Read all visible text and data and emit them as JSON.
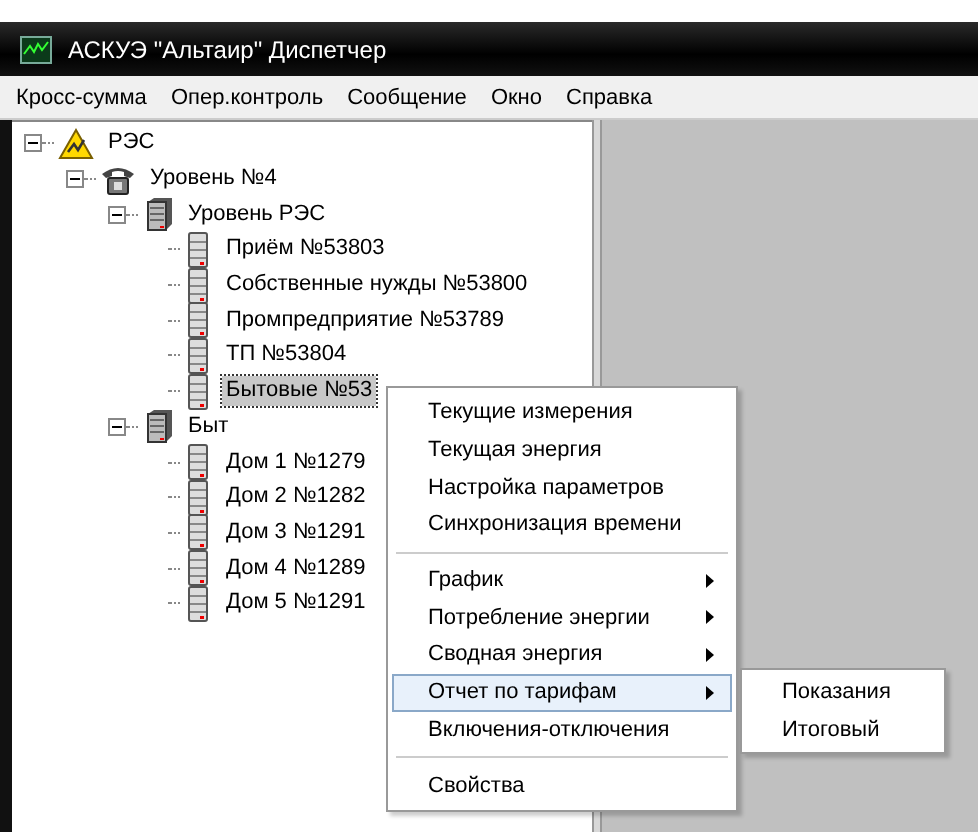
{
  "window": {
    "title": "АСКУЭ \"Альтаир\" Диспетчер"
  },
  "menu_bar": [
    "Кросс-сумма",
    "Опер.контроль",
    "Сообщение",
    "Окно",
    "Справка"
  ],
  "tree": [
    {
      "label": "РЭС",
      "kind": "warning",
      "expanded": true,
      "selected": false,
      "children": [
        {
          "label": "Уровень №4",
          "kind": "phone",
          "expanded": true,
          "selected": false,
          "children": [
            {
              "label": "Уровень РЭС",
              "kind": "server",
              "expanded": true,
              "selected": false,
              "children": [
                {
                  "label": "Приём №53803",
                  "kind": "meter",
                  "selected": false
                },
                {
                  "label": "Собственные нужды №53800",
                  "kind": "meter",
                  "selected": false
                },
                {
                  "label": "Промпредприятие №53789",
                  "kind": "meter",
                  "selected": false
                },
                {
                  "label": "ТП №53804",
                  "kind": "meter",
                  "selected": false
                },
                {
                  "label": "Бытовые №53",
                  "kind": "meter",
                  "selected": true
                }
              ]
            },
            {
              "label": "Быт",
              "kind": "server",
              "expanded": true,
              "selected": false,
              "children": [
                {
                  "label": "Дом 1 №1279",
                  "kind": "meter",
                  "selected": false
                },
                {
                  "label": "Дом 2 №1282",
                  "kind": "meter",
                  "selected": false
                },
                {
                  "label": "Дом 3 №1291",
                  "kind": "meter",
                  "selected": false
                },
                {
                  "label": "Дом 4 №1289",
                  "kind": "meter",
                  "selected": false
                },
                {
                  "label": "Дом 5 №1291",
                  "kind": "meter",
                  "selected": false
                }
              ]
            }
          ]
        }
      ]
    }
  ],
  "context_menu": [
    {
      "kind": "item",
      "label": "Текущие измерения",
      "selected": false
    },
    {
      "kind": "item",
      "label": "Текущая энергия",
      "selected": false
    },
    {
      "kind": "item",
      "label": "Настройка параметров",
      "selected": false
    },
    {
      "kind": "item",
      "label": "Синхронизация времени",
      "selected": false
    },
    {
      "kind": "separator"
    },
    {
      "kind": "submenu",
      "label": "График",
      "selected": false
    },
    {
      "kind": "submenu",
      "label": "Потребление энергии",
      "selected": false
    },
    {
      "kind": "submenu",
      "label": "Сводная энергия",
      "selected": false
    },
    {
      "kind": "submenu",
      "label": "Отчет по тарифам",
      "selected": true
    },
    {
      "kind": "item",
      "label": "Включения-отключения",
      "selected": false
    },
    {
      "kind": "separator"
    },
    {
      "kind": "item",
      "label": "Свойства",
      "selected": false
    }
  ],
  "submenu": [
    {
      "label": "Показания",
      "selected": false
    },
    {
      "label": "Итоговый",
      "selected": false
    }
  ]
}
